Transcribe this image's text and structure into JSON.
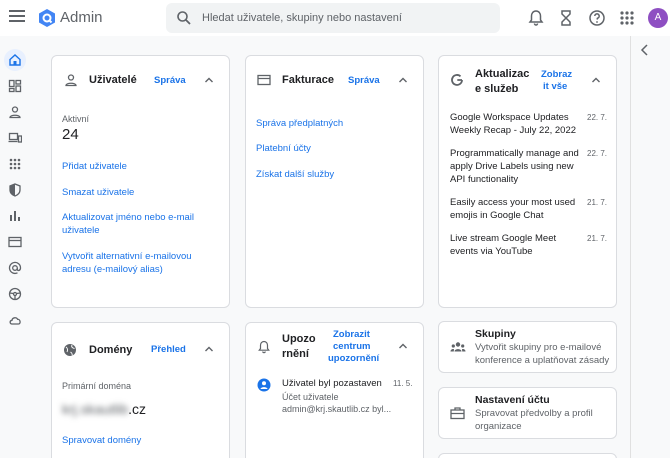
{
  "header": {
    "title": "Admin",
    "search_placeholder": "Hledat uživatele, skupiny nebo nastavení",
    "avatar_letter": "A"
  },
  "colors": {
    "accent": "#1a73e8",
    "avatar": "#8e4fc2",
    "logo": "#4285f4"
  },
  "users": {
    "title": "Uživatelé",
    "manage": "Správa",
    "active_label": "Aktivní",
    "active_count": "24",
    "links": [
      "Přidat uživatele",
      "Smazat uživatele",
      "Aktualizovat jméno nebo e-mail uživatele",
      "Vytvořit alternativní e-mailovou adresu (e-mailový alias)"
    ]
  },
  "billing": {
    "title": "Fakturace",
    "manage": "Správa",
    "links": [
      "Správa předplatných",
      "Platební účty",
      "Získat další služby"
    ]
  },
  "updates": {
    "title_line1": "Aktualizac",
    "title_line2": "e služeb",
    "show_all_line1": "Zobraz",
    "show_all_line2": "it vše",
    "items": [
      {
        "text": "Google Workspace Updates Weekly Recap - July 22, 2022",
        "date": "22. 7."
      },
      {
        "text": "Programmatically manage and apply Drive Labels using new API functionality",
        "date": "22. 7."
      },
      {
        "text": "Easily access your most used emojis in Google Chat",
        "date": "21. 7."
      },
      {
        "text": "Live stream Google Meet events via YouTube",
        "date": "21. 7."
      }
    ]
  },
  "domains": {
    "title": "Domény",
    "overview": "Přehled",
    "primary_label": "Primární doména",
    "domain_hidden": "krj.skautlib",
    "domain_suffix": ".cz",
    "manage_link": "Spravovat domény"
  },
  "alerts": {
    "title_line1": "Upozo",
    "title_line2": "rnění",
    "link_line1": "Zobrazit",
    "link_line2": "centrum",
    "link_line3": "upozornění",
    "item": {
      "title": "Uživatel byl pozastaven",
      "date": "11. 5.",
      "sub1": "Účet uživatele",
      "sub2": "admin@krj.skautlib.cz byl..."
    }
  },
  "tiles": [
    {
      "title": "Skupiny",
      "desc": "Vytvořit skupiny pro e-mailové konference a uplatňovat zásady"
    },
    {
      "title": "Nastavení účtu",
      "desc": "Spravovat předvolby a profil organizace"
    }
  ]
}
